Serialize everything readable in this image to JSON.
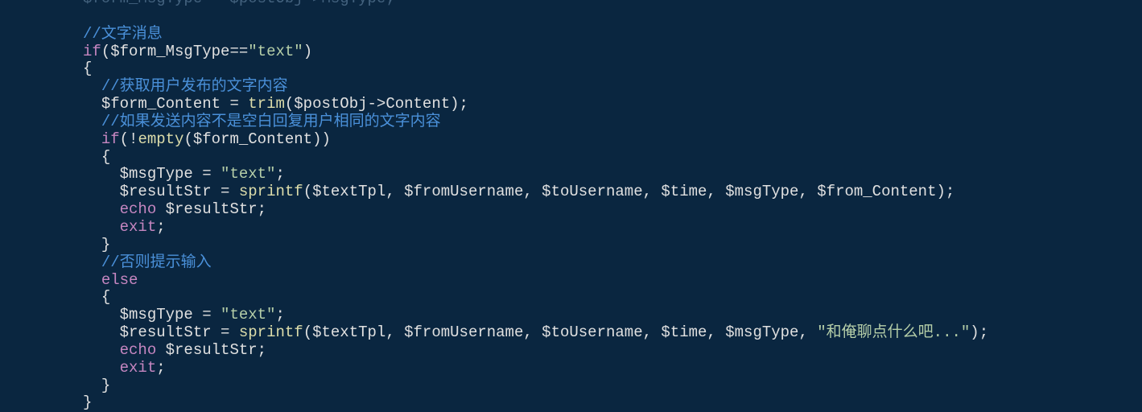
{
  "code": {
    "line0_faded": "$form_MsgType = $postObj->MsgType;",
    "comment1": "//文字消息",
    "if1_open": "if",
    "if1_expr_var": "$form_MsgType",
    "if1_expr_op": "==",
    "if1_expr_str": "\"text\"",
    "brace_open": "{",
    "brace_close": "}",
    "comment2": "//获取用户发布的文字内容",
    "assign1_var": "$form_Content",
    "assign1_eq": " = ",
    "assign1_fn": "trim",
    "assign1_arg_var": "$postObj",
    "assign1_arg_arrow": "->",
    "assign1_arg_prop": "Content",
    "comment3": "//如果发送内容不是空白回复用户相同的文字内容",
    "if2_open": "if",
    "if2_not": "!",
    "if2_fn": "empty",
    "if2_arg": "$form_Content",
    "msgType_var": "$msgType",
    "msgType_eq": " = ",
    "msgType_str": "\"text\"",
    "resultStr_var": "$resultStr",
    "resultStr_eq": " = ",
    "sprintf_fn": "sprintf",
    "sprintf_arg1": "$textTpl",
    "sprintf_arg2": "$fromUsername",
    "sprintf_arg3": "$toUsername",
    "sprintf_arg4": "$time",
    "sprintf_arg5": "$msgType",
    "sprintf_arg6a": "$from_Content",
    "sprintf_arg6b": "\"和俺聊点什么吧...\"",
    "echo_kw": "echo",
    "echo_var": "$resultStr",
    "exit_kw": "exit",
    "comment4": "//否则提示输入",
    "else_kw": "else",
    "semi": ";",
    "comma": ", ",
    "paren_open": "(",
    "paren_close": ")"
  }
}
